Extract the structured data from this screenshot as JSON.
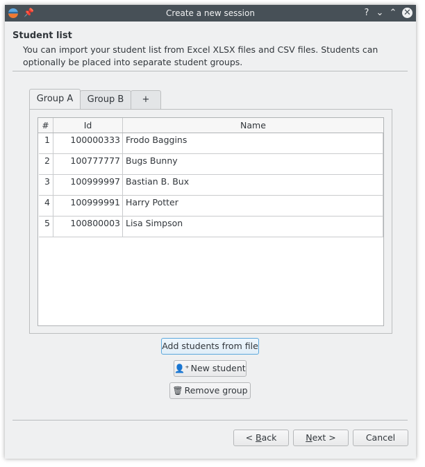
{
  "window": {
    "title": "Create a new session",
    "controls": {
      "help": "?",
      "minimize": "⌄",
      "maximize": "⌃",
      "close": "✕"
    }
  },
  "section": {
    "heading": "Student list",
    "description": "You can import your student list from Excel XLSX files and CSV files. Students can optionally be placed into separate student groups."
  },
  "tabs": [
    {
      "label": "Group A",
      "active": true
    },
    {
      "label": "Group B",
      "active": false
    },
    {
      "label": "+",
      "active": false
    }
  ],
  "table": {
    "columns": [
      "#",
      "Id",
      "Name"
    ],
    "rows": [
      {
        "num": "1",
        "id": "100000333",
        "name": "Frodo Baggins"
      },
      {
        "num": "2",
        "id": "100777777",
        "name": "Bugs Bunny"
      },
      {
        "num": "3",
        "id": "100999997",
        "name": "Bastian B. Bux"
      },
      {
        "num": "4",
        "id": "100999991",
        "name": "Harry Potter"
      },
      {
        "num": "5",
        "id": "100800003",
        "name": "Lisa Simpson"
      }
    ]
  },
  "actions": {
    "add_from_file": "Add students from file",
    "new_student": "New student",
    "remove_group": "Remove group"
  },
  "footer": {
    "back_prefix": "< ",
    "back_key": "B",
    "back_rest": "ack",
    "next_key": "N",
    "next_rest": "ext >",
    "cancel": "Cancel"
  },
  "colors": {
    "titlebar": "#475057",
    "window_bg": "#eff0f1",
    "focus": "#5ca8dc"
  },
  "icons": {
    "app": "app-logo-icon",
    "pin": "pin-icon",
    "new_student": "add-user-icon",
    "remove_group": "trash-icon"
  }
}
